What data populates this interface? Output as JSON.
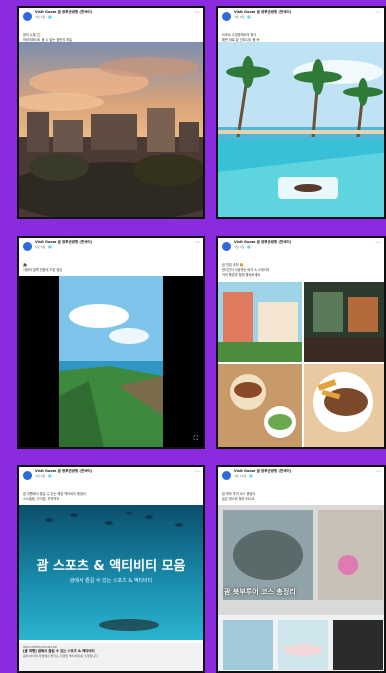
{
  "colors": {
    "background": "#8b2be0",
    "facebook_blue": "#2b6cd8"
  },
  "posts": [
    {
      "author": "Visit Guam 괌 정부관광청 (한국어)",
      "meta": "3월 1일 · 🌐",
      "body": [
        "괌의 노을 🌅",
        "하와이에서도 볼 수 없는 괌만의 하늘"
      ],
      "media": "sunset-city"
    },
    {
      "author": "Visit Guam 괌 정부관광청 (한국어)",
      "meta": "3월 3일 · 🌐",
      "body": [
        "리조트 수영장에서의 휴식",
        "해변 바로 앞 인피니티 풀 🌴"
      ],
      "media": "pool-palms"
    },
    {
      "author": "Visit Guam 괌 정부관광청 (한국어)",
      "meta": "3월 5일 · 🌐",
      "body": [
        "🎥",
        "사랑의 절벽 전망대 드론 영상"
      ],
      "media": "cliff-video"
    },
    {
      "author": "Visit Guam 괌 정부관광청 (한국어)",
      "meta": "3월 7일 · 🌐",
      "body": [
        "괌 맛집 추천 🍔",
        "현지인이 사랑하는 버거 & 스테이크",
        "거리 풍경과 함께 즐겨보세요"
      ],
      "media": "food-grid"
    },
    {
      "author": "Visit Guam 괌 정부관광청 (한국어)",
      "meta": "3월 9일 · 🌐",
      "body": [
        "괌 여행에서 즐길 수 있는 해양 액티비티 총정리",
        "스노클링, 다이빙, 카약까지"
      ],
      "media": "sports-banner",
      "banner_title": "괌 스포츠 & 액티비티 모음",
      "banner_subtitle": "괌에서 즐길 수 있는 스포츠 & 액티비티",
      "link_site": "WELCOMETOGUAM.KR",
      "link_title": "[괌 여행] 괌에서 즐길 수 있는 스포츠 & 액티비티",
      "link_desc": "괌의 바다와 자연에서 즐기는 다양한 액티비티를 소개합니다"
    },
    {
      "author": "Visit Guam 괌 정부관광청 (한국어)",
      "meta": "3월 11일 · 🌐",
      "body": [
        "괌 북부 투어 코스 총정리",
        "숨은 명소를 찾아 떠나요"
      ],
      "media": "north-tour",
      "banner_title": "괌 북부투어 코스 총정리"
    }
  ]
}
